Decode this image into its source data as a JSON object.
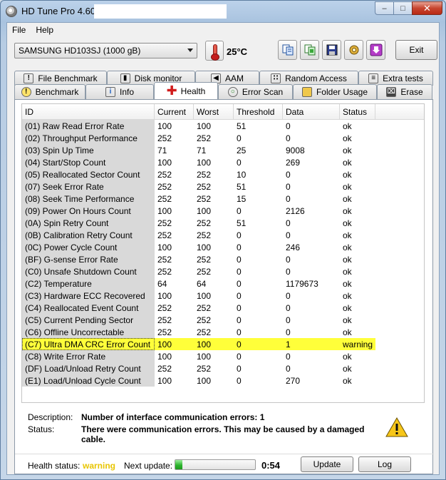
{
  "window": {
    "title": "HD Tune Pro 4.60 -",
    "caption_buttons": {
      "minimize": "–",
      "maximize": "□",
      "close": "✕"
    }
  },
  "menu": [
    "File",
    "Help"
  ],
  "toolbar": {
    "drive": "SAMSUNG HD103SJ (1000 gB)",
    "temperature": "25°C",
    "exit_label": "Exit",
    "icons": [
      "copy-text-icon",
      "copy-screenshot-icon",
      "save-icon",
      "options-icon",
      "download-icon"
    ]
  },
  "tabs": {
    "back": [
      {
        "label": "File Benchmark",
        "icon": "file-benchmark-icon"
      },
      {
        "label": "Disk monitor",
        "icon": "disk-monitor-icon"
      },
      {
        "label": "AAM",
        "icon": "speaker-icon"
      },
      {
        "label": "Random Access",
        "icon": "random-access-icon"
      },
      {
        "label": "Extra tests",
        "icon": "extra-tests-icon"
      }
    ],
    "front": [
      {
        "label": "Benchmark",
        "icon": "bulb-icon"
      },
      {
        "label": "Info",
        "icon": "info-icon"
      },
      {
        "label": "Health",
        "icon": "health-cross-icon"
      },
      {
        "label": "Error Scan",
        "icon": "magnifier-icon"
      },
      {
        "label": "Folder Usage",
        "icon": "folder-icon"
      },
      {
        "label": "Erase",
        "icon": "trash-icon"
      }
    ],
    "active": "Health"
  },
  "table": {
    "headers": [
      "ID",
      "Current",
      "Worst",
      "Threshold",
      "Data",
      "Status"
    ],
    "rows": [
      [
        "(01) Raw Read Error Rate",
        "100",
        "100",
        "51",
        "0",
        "ok"
      ],
      [
        "(02) Throughput Performance",
        "252",
        "252",
        "0",
        "0",
        "ok"
      ],
      [
        "(03) Spin Up Time",
        "71",
        "71",
        "25",
        "9008",
        "ok"
      ],
      [
        "(04) Start/Stop Count",
        "100",
        "100",
        "0",
        "269",
        "ok"
      ],
      [
        "(05) Reallocated Sector Count",
        "252",
        "252",
        "10",
        "0",
        "ok"
      ],
      [
        "(07) Seek Error Rate",
        "252",
        "252",
        "51",
        "0",
        "ok"
      ],
      [
        "(08) Seek Time Performance",
        "252",
        "252",
        "15",
        "0",
        "ok"
      ],
      [
        "(09) Power On Hours Count",
        "100",
        "100",
        "0",
        "2126",
        "ok"
      ],
      [
        "(0A) Spin Retry Count",
        "252",
        "252",
        "51",
        "0",
        "ok"
      ],
      [
        "(0B) Calibration Retry Count",
        "252",
        "252",
        "0",
        "0",
        "ok"
      ],
      [
        "(0C) Power Cycle Count",
        "100",
        "100",
        "0",
        "246",
        "ok"
      ],
      [
        "(BF) G-sense Error Rate",
        "252",
        "252",
        "0",
        "0",
        "ok"
      ],
      [
        "(C0) Unsafe Shutdown Count",
        "252",
        "252",
        "0",
        "0",
        "ok"
      ],
      [
        "(C2) Temperature",
        "64",
        "64",
        "0",
        "1179673",
        "ok"
      ],
      [
        "(C3) Hardware ECC Recovered",
        "100",
        "100",
        "0",
        "0",
        "ok"
      ],
      [
        "(C4) Reallocated Event Count",
        "252",
        "252",
        "0",
        "0",
        "ok"
      ],
      [
        "(C5) Current Pending Sector",
        "252",
        "252",
        "0",
        "0",
        "ok"
      ],
      [
        "(C6) Offline Uncorrectable",
        "252",
        "252",
        "0",
        "0",
        "ok"
      ],
      [
        "(C7) Ultra DMA CRC Error Count",
        "100",
        "100",
        "0",
        "1",
        "warning"
      ],
      [
        "(C8) Write Error Rate",
        "100",
        "100",
        "0",
        "0",
        "ok"
      ],
      [
        "(DF) Load/Unload Retry Count",
        "252",
        "252",
        "0",
        "0",
        "ok"
      ],
      [
        "(E1) Load/Unload Cycle Count",
        "100",
        "100",
        "0",
        "270",
        "ok"
      ]
    ],
    "selected_row": 18,
    "highlight_color": "#ffff3a"
  },
  "details": {
    "description_label": "Description:",
    "description": "Number of interface communication errors: 1",
    "status_label": "Status:",
    "status": "There were communication errors. This may be caused by a damaged cable."
  },
  "status_bar": {
    "health_label": "Health status:",
    "health_value": "warning",
    "health_color": "#e8c500",
    "next_update_label": "Next update:",
    "progress": 0.09,
    "countdown": "0:54",
    "update_label": "Update",
    "log_label": "Log"
  }
}
